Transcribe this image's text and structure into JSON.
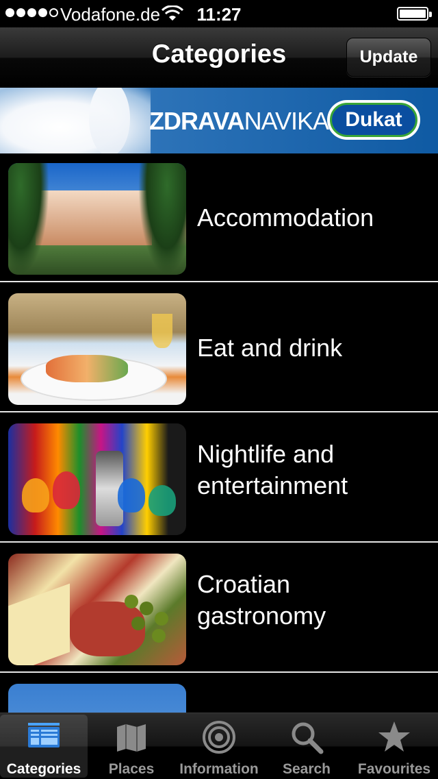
{
  "status_bar": {
    "carrier": "Vodafone.de",
    "time": "11:27",
    "signal_bars": 4,
    "signal_total": 5
  },
  "nav": {
    "title": "Categories",
    "update_label": "Update"
  },
  "banner": {
    "brand_bold": "ZDRAVA",
    "brand_regular": "NAVIKA",
    "logo_text": "Dukat"
  },
  "categories": [
    {
      "label": "Accommodation",
      "line2": ""
    },
    {
      "label": "Eat and drink",
      "line2": ""
    },
    {
      "label": "Nightlife and",
      "line2": "entertainment"
    },
    {
      "label": "Croatian",
      "line2": "gastronomy"
    }
  ],
  "tabbar": {
    "tabs": [
      {
        "label": "Categories",
        "icon": "categories-icon",
        "selected": true
      },
      {
        "label": "Places",
        "icon": "map-icon",
        "selected": false
      },
      {
        "label": "Information",
        "icon": "target-icon",
        "selected": false
      },
      {
        "label": "Search",
        "icon": "search-icon",
        "selected": false
      },
      {
        "label": "Favourites",
        "icon": "star-icon",
        "selected": false
      }
    ]
  },
  "colors": {
    "background": "#000000",
    "selected_tab_text": "#ffffff",
    "unselected_tab_text": "#9a9a9a",
    "selected_icon": "#4a90e2"
  }
}
